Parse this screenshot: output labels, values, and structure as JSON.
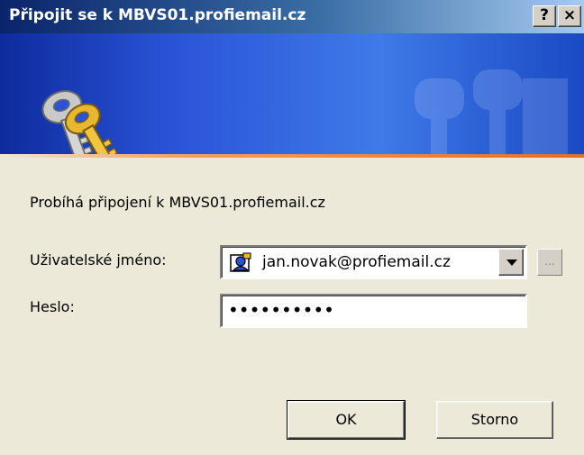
{
  "window": {
    "title": "Připojit se k MBVS01.profiemail.cz",
    "help_button": "?",
    "close_button": "×"
  },
  "banner": {
    "icon": "keys-icon",
    "colors": {
      "accent_line": "#f08a3a",
      "banner": "#2a54d8"
    }
  },
  "body": {
    "message": "Probíhá připojení k MBVS01.profiemail.cz",
    "username_label": "Uživatelské jméno:",
    "username_value": "jan.novak@profiemail.cz",
    "username_icon": "user-card-icon",
    "browse_button": "...",
    "password_label": "Heslo:",
    "password_value": "••••••••••"
  },
  "buttons": {
    "ok": "OK",
    "cancel": "Storno"
  }
}
